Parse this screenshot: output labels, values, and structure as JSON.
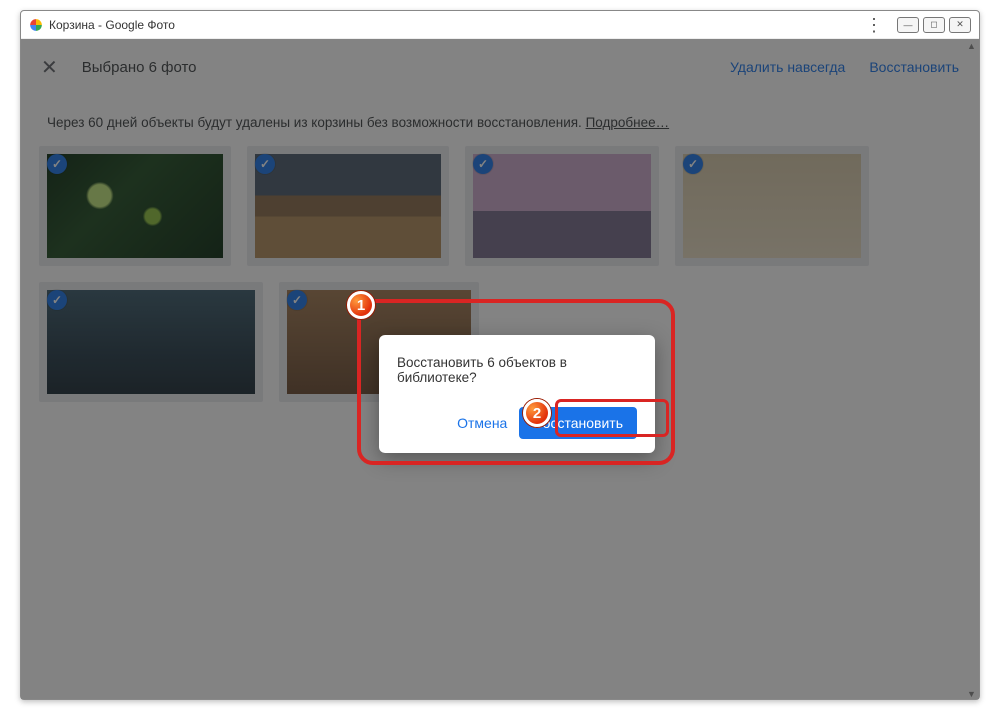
{
  "window": {
    "title": "Корзина - Google Фото"
  },
  "appbar": {
    "selection_text": "Выбрано 6 фото",
    "delete_forever": "Удалить навсегда",
    "restore": "Восстановить"
  },
  "notice": {
    "text": "Через 60 дней объекты будут удалены из корзины без возможности восстановления.",
    "more": "Подробнее…"
  },
  "dialog": {
    "message": "Восстановить 6 объектов в библиотеке?",
    "cancel": "Отмена",
    "confirm": "Восстановить"
  },
  "badges": {
    "one": "1",
    "two": "2"
  },
  "thumbs": {
    "count": 6,
    "selected": [
      true,
      true,
      true,
      true,
      true,
      true
    ]
  }
}
